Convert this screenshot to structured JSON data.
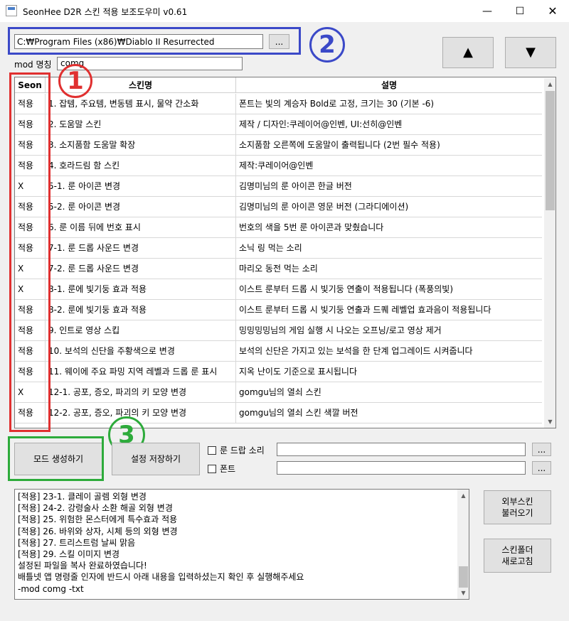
{
  "window": {
    "title": "SeonHee D2R 스킨 적용 보조도우미 v0.61",
    "minimize_glyph": "—",
    "maximize_glyph": "☐",
    "close_glyph": "✕"
  },
  "path": {
    "value": "C:₩Program Files (x86)₩Diablo II Resurrected",
    "browse_label": "..."
  },
  "annotations": {
    "one": "1",
    "two": "2",
    "three": "3",
    "colors": {
      "blue": "#3b49c8",
      "red": "#e03030",
      "green": "#2dab3b"
    }
  },
  "move_buttons": {
    "up": "▲",
    "down": "▼"
  },
  "mod": {
    "label": "mod 명칭",
    "value": "comg"
  },
  "grid": {
    "headers": {
      "seon": "Seon",
      "skin": "스킨명",
      "desc": "설명"
    },
    "rows": [
      {
        "seon": "적용",
        "skin": "1. 잡템, 주요템, 변동템 표시, 물약 간소화",
        "desc": "폰트는 빛의 계승자 Bold로 고정, 크기는 30 (기본 -6)"
      },
      {
        "seon": "적용",
        "skin": "2. 도움말 스킨",
        "desc": "제작 / 디자인:쿠레이어@인벤, UI:선히@인벤"
      },
      {
        "seon": "적용",
        "skin": "3. 소지품함 도움말 확장",
        "desc": "소지품함 오른쪽에 도움말이 출력됩니다 (2번 필수 적용)"
      },
      {
        "seon": "적용",
        "skin": "4. 호라드림 함 스킨",
        "desc": "제작:쿠레이어@인벤"
      },
      {
        "seon": "X",
        "skin": "5-1. 룬 아이콘 변경",
        "desc": "김명미님의 룬 아이콘 한글 버전"
      },
      {
        "seon": "적용",
        "skin": "5-2. 룬 아이콘 변경",
        "desc": "김명미님의 룬 아이콘 영문 버전 (그라디에이션)"
      },
      {
        "seon": "적용",
        "skin": "6. 룬 이름 뒤에 번호 표시",
        "desc": "번호의 색을 5번 룬 아이콘과 맞췄습니다"
      },
      {
        "seon": "적용",
        "skin": "7-1. 룬 드롭 사운드 변경",
        "desc": "소닉 링 먹는 소리"
      },
      {
        "seon": "X",
        "skin": "7-2. 룬 드롭 사운드 변경",
        "desc": "마리오 동전 먹는 소리"
      },
      {
        "seon": "X",
        "skin": "8-1. 룬에 빛기둥 효과 적용",
        "desc": "이스트 룬부터 드롭 시 빛기둥 연출이 적용됩니다 (폭풍의빛)"
      },
      {
        "seon": "적용",
        "skin": "8-2. 룬에 빛기둥 효과 적용",
        "desc": "이스트 룬부터 드롭 시 빛기둥 연출과 드퀘 레벨업 효과음이 적용됩니다"
      },
      {
        "seon": "적용",
        "skin": "9. 인트로 영상 스킵",
        "desc": "밍밍밍밍님의 게임 실행 시 나오는 오프닝/로고 영상 제거"
      },
      {
        "seon": "적용",
        "skin": "10. 보석의 신단을 주황색으로 변경",
        "desc": "보석의 신단은 가지고 있는 보석을 한 단계 업그레이드 시켜줍니다"
      },
      {
        "seon": "적용",
        "skin": "11. 웨이에 주요 파밍 지역 레벨과 드롭 룬 표시",
        "desc": "지옥 난이도 기준으로 표시됩니다"
      },
      {
        "seon": "X",
        "skin": "12-1. 공포, 증오, 파괴의 키 모양 변경",
        "desc": "gomgu님의 열쇠 스킨"
      },
      {
        "seon": "적용",
        "skin": "12-2. 공포, 증오, 파괴의 키 모양 변경",
        "desc": "gomgu님의 열쇠 스킨 색깔 버전"
      }
    ]
  },
  "buttons": {
    "make_mod": "모드 생성하기",
    "save_settings": "설정 저장하기",
    "load_external_line1": "외부스킨",
    "load_external_line2": "불러오기",
    "refresh_line1": "스킨폴더",
    "refresh_line2": "새로고침"
  },
  "options": {
    "rune_drop_sound": "룬 드랍 소리",
    "font": "폰트",
    "browse_label": "..."
  },
  "log": {
    "lines": [
      "[적용] 23-1. 클레이 골렘 외형 변경",
      "[적용] 24-2. 강령술사 소환 해골 외형 변경",
      "[적용] 25. 위험한 몬스터에게 특수효과 적용",
      "[적용] 26. 바위와 상자, 시체 등의 외형 변경",
      "[적용] 27. 트리스트럼 날씨 맑음",
      "[적용] 29. 스킬 이미지 변경",
      "설정된 파일을 복사 완료하였습니다!",
      "배틀넷 앱 명령줄 인자에 반드시 아래 내용을 입력하셨는지 확인 후 실행해주세요",
      " -mod comg -txt"
    ]
  }
}
